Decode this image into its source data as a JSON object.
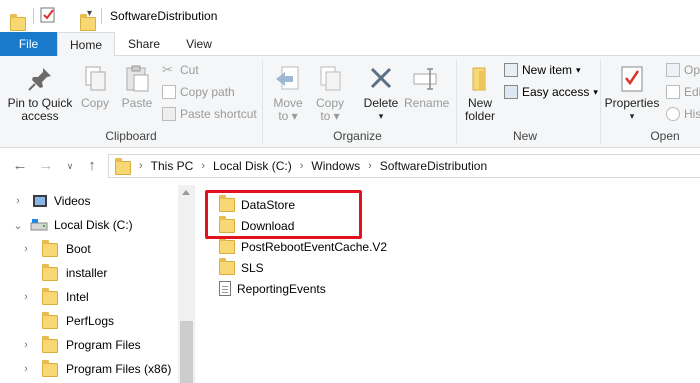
{
  "window": {
    "title": "SoftwareDistribution"
  },
  "tabs": [
    "File",
    "Home",
    "Share",
    "View"
  ],
  "ribbon": {
    "clipboard": {
      "pin_label_1": "Pin to Quick",
      "pin_label_2": "access",
      "copy": "Copy",
      "paste": "Paste",
      "cut": "Cut",
      "copy_path": "Copy path",
      "paste_shortcut": "Paste shortcut",
      "group": "Clipboard"
    },
    "organize": {
      "move_to_1": "Move",
      "move_to_2": "to",
      "copy_to_1": "Copy",
      "copy_to_2": "to",
      "delete": "Delete",
      "rename": "Rename",
      "group": "Organize"
    },
    "new": {
      "new_folder_1": "New",
      "new_folder_2": "folder",
      "new_item": "New item",
      "easy_access": "Easy access",
      "group": "New"
    },
    "open": {
      "properties": "Properties",
      "open": "Op",
      "edit": "Edi",
      "history": "Hist",
      "group": "Open"
    }
  },
  "breadcrumb": [
    "This PC",
    "Local Disk (C:)",
    "Windows",
    "SoftwareDistribution"
  ],
  "nav_tree": [
    {
      "label": "Videos",
      "icon": "videos-icon",
      "expand": ">"
    },
    {
      "label": "Local Disk (C:)",
      "icon": "drive-icon",
      "expand": "v"
    },
    {
      "label": "Boot",
      "icon": "folder-icon",
      "expand": ">"
    },
    {
      "label": "installer",
      "icon": "folder-icon",
      "expand": ""
    },
    {
      "label": "Intel",
      "icon": "folder-icon",
      "expand": ">"
    },
    {
      "label": "PerfLogs",
      "icon": "folder-icon",
      "expand": ""
    },
    {
      "label": "Program Files",
      "icon": "folder-icon",
      "expand": ">"
    },
    {
      "label": "Program Files (x86)",
      "icon": "folder-icon",
      "expand": ">"
    }
  ],
  "files": [
    {
      "name": "DataStore",
      "type": "folder"
    },
    {
      "name": "Download",
      "type": "folder"
    },
    {
      "name": "PostRebootEventCache.V2",
      "type": "folder"
    },
    {
      "name": "SLS",
      "type": "folder"
    },
    {
      "name": "ReportingEvents",
      "type": "file"
    }
  ],
  "colors": {
    "file_tab": "#1979ca",
    "highlight": "#e3101d",
    "folder": "#f8d775"
  }
}
